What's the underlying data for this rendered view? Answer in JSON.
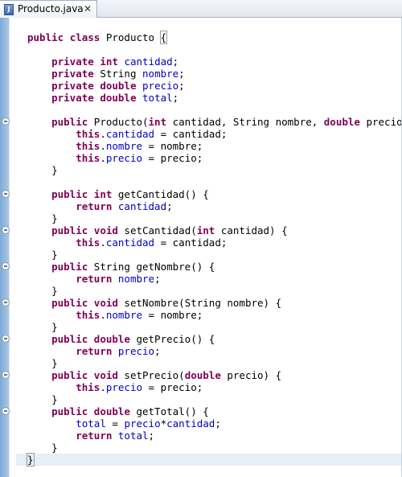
{
  "tab": {
    "title": "Producto.java",
    "icon": "java-file-icon",
    "close_icon": "close-icon"
  },
  "colors": {
    "keyword": "#7f0055",
    "field": "#0000c0",
    "text": "#000000",
    "current_line": "#e6eef8"
  },
  "lines": [
    {
      "fold": false,
      "tokens": [
        {
          "t": "kw",
          "s": "public"
        },
        {
          "t": "p",
          "s": " "
        },
        {
          "t": "kw",
          "s": "class"
        },
        {
          "t": "p",
          "s": " Producto "
        },
        {
          "t": "b",
          "s": "{"
        }
      ]
    },
    {
      "fold": false,
      "tokens": []
    },
    {
      "fold": false,
      "tokens": [
        {
          "t": "p",
          "s": "    "
        },
        {
          "t": "kw",
          "s": "private"
        },
        {
          "t": "p",
          "s": " "
        },
        {
          "t": "kw",
          "s": "int"
        },
        {
          "t": "p",
          "s": " "
        },
        {
          "t": "f",
          "s": "cantidad"
        },
        {
          "t": "p",
          "s": ";"
        }
      ]
    },
    {
      "fold": false,
      "tokens": [
        {
          "t": "p",
          "s": "    "
        },
        {
          "t": "kw",
          "s": "private"
        },
        {
          "t": "p",
          "s": " String "
        },
        {
          "t": "f",
          "s": "nombre"
        },
        {
          "t": "p",
          "s": ";"
        }
      ]
    },
    {
      "fold": false,
      "tokens": [
        {
          "t": "p",
          "s": "    "
        },
        {
          "t": "kw",
          "s": "private"
        },
        {
          "t": "p",
          "s": " "
        },
        {
          "t": "kw",
          "s": "double"
        },
        {
          "t": "p",
          "s": " "
        },
        {
          "t": "f",
          "s": "precio"
        },
        {
          "t": "p",
          "s": ";"
        }
      ]
    },
    {
      "fold": false,
      "tokens": [
        {
          "t": "p",
          "s": "    "
        },
        {
          "t": "kw",
          "s": "private"
        },
        {
          "t": "p",
          "s": " "
        },
        {
          "t": "kw",
          "s": "double"
        },
        {
          "t": "p",
          "s": " "
        },
        {
          "t": "f",
          "s": "total"
        },
        {
          "t": "p",
          "s": ";"
        }
      ]
    },
    {
      "fold": false,
      "tokens": []
    },
    {
      "fold": true,
      "tokens": [
        {
          "t": "p",
          "s": "    "
        },
        {
          "t": "kw",
          "s": "public"
        },
        {
          "t": "p",
          "s": " Producto("
        },
        {
          "t": "kw",
          "s": "int"
        },
        {
          "t": "p",
          "s": " cantidad, String nombre, "
        },
        {
          "t": "kw",
          "s": "double"
        },
        {
          "t": "p",
          "s": " precio) {"
        }
      ]
    },
    {
      "fold": false,
      "tokens": [
        {
          "t": "p",
          "s": "        "
        },
        {
          "t": "kw",
          "s": "this"
        },
        {
          "t": "p",
          "s": "."
        },
        {
          "t": "f",
          "s": "cantidad"
        },
        {
          "t": "p",
          "s": " = cantidad;"
        }
      ]
    },
    {
      "fold": false,
      "tokens": [
        {
          "t": "p",
          "s": "        "
        },
        {
          "t": "kw",
          "s": "this"
        },
        {
          "t": "p",
          "s": "."
        },
        {
          "t": "f",
          "s": "nombre"
        },
        {
          "t": "p",
          "s": " = nombre;"
        }
      ]
    },
    {
      "fold": false,
      "tokens": [
        {
          "t": "p",
          "s": "        "
        },
        {
          "t": "kw",
          "s": "this"
        },
        {
          "t": "p",
          "s": "."
        },
        {
          "t": "f",
          "s": "precio"
        },
        {
          "t": "p",
          "s": " = precio;"
        }
      ]
    },
    {
      "fold": false,
      "tokens": [
        {
          "t": "p",
          "s": "    }"
        }
      ]
    },
    {
      "fold": false,
      "tokens": []
    },
    {
      "fold": true,
      "tokens": [
        {
          "t": "p",
          "s": "    "
        },
        {
          "t": "kw",
          "s": "public"
        },
        {
          "t": "p",
          "s": " "
        },
        {
          "t": "kw",
          "s": "int"
        },
        {
          "t": "p",
          "s": " getCantidad() {"
        }
      ]
    },
    {
      "fold": false,
      "tokens": [
        {
          "t": "p",
          "s": "        "
        },
        {
          "t": "kw",
          "s": "return"
        },
        {
          "t": "p",
          "s": " "
        },
        {
          "t": "f",
          "s": "cantidad"
        },
        {
          "t": "p",
          "s": ";"
        }
      ]
    },
    {
      "fold": false,
      "tokens": [
        {
          "t": "p",
          "s": "    }"
        }
      ]
    },
    {
      "fold": true,
      "tokens": [
        {
          "t": "p",
          "s": "    "
        },
        {
          "t": "kw",
          "s": "public"
        },
        {
          "t": "p",
          "s": " "
        },
        {
          "t": "kw",
          "s": "void"
        },
        {
          "t": "p",
          "s": " setCantidad("
        },
        {
          "t": "kw",
          "s": "int"
        },
        {
          "t": "p",
          "s": " cantidad) {"
        }
      ]
    },
    {
      "fold": false,
      "tokens": [
        {
          "t": "p",
          "s": "        "
        },
        {
          "t": "kw",
          "s": "this"
        },
        {
          "t": "p",
          "s": "."
        },
        {
          "t": "f",
          "s": "cantidad"
        },
        {
          "t": "p",
          "s": " = cantidad;"
        }
      ]
    },
    {
      "fold": false,
      "tokens": [
        {
          "t": "p",
          "s": "    }"
        }
      ]
    },
    {
      "fold": true,
      "tokens": [
        {
          "t": "p",
          "s": "    "
        },
        {
          "t": "kw",
          "s": "public"
        },
        {
          "t": "p",
          "s": " String getNombre() {"
        }
      ]
    },
    {
      "fold": false,
      "tokens": [
        {
          "t": "p",
          "s": "        "
        },
        {
          "t": "kw",
          "s": "return"
        },
        {
          "t": "p",
          "s": " "
        },
        {
          "t": "f",
          "s": "nombre"
        },
        {
          "t": "p",
          "s": ";"
        }
      ]
    },
    {
      "fold": false,
      "tokens": [
        {
          "t": "p",
          "s": "    }"
        }
      ]
    },
    {
      "fold": true,
      "tokens": [
        {
          "t": "p",
          "s": "    "
        },
        {
          "t": "kw",
          "s": "public"
        },
        {
          "t": "p",
          "s": " "
        },
        {
          "t": "kw",
          "s": "void"
        },
        {
          "t": "p",
          "s": " setNombre(String nombre) {"
        }
      ]
    },
    {
      "fold": false,
      "tokens": [
        {
          "t": "p",
          "s": "        "
        },
        {
          "t": "kw",
          "s": "this"
        },
        {
          "t": "p",
          "s": "."
        },
        {
          "t": "f",
          "s": "nombre"
        },
        {
          "t": "p",
          "s": " = nombre;"
        }
      ]
    },
    {
      "fold": false,
      "tokens": [
        {
          "t": "p",
          "s": "    }"
        }
      ]
    },
    {
      "fold": true,
      "tokens": [
        {
          "t": "p",
          "s": "    "
        },
        {
          "t": "kw",
          "s": "public"
        },
        {
          "t": "p",
          "s": " "
        },
        {
          "t": "kw",
          "s": "double"
        },
        {
          "t": "p",
          "s": " getPrecio() {"
        }
      ]
    },
    {
      "fold": false,
      "tokens": [
        {
          "t": "p",
          "s": "        "
        },
        {
          "t": "kw",
          "s": "return"
        },
        {
          "t": "p",
          "s": " "
        },
        {
          "t": "f",
          "s": "precio"
        },
        {
          "t": "p",
          "s": ";"
        }
      ]
    },
    {
      "fold": false,
      "tokens": [
        {
          "t": "p",
          "s": "    }"
        }
      ]
    },
    {
      "fold": true,
      "tokens": [
        {
          "t": "p",
          "s": "    "
        },
        {
          "t": "kw",
          "s": "public"
        },
        {
          "t": "p",
          "s": " "
        },
        {
          "t": "kw",
          "s": "void"
        },
        {
          "t": "p",
          "s": " setPrecio("
        },
        {
          "t": "kw",
          "s": "double"
        },
        {
          "t": "p",
          "s": " precio) {"
        }
      ]
    },
    {
      "fold": false,
      "tokens": [
        {
          "t": "p",
          "s": "        "
        },
        {
          "t": "kw",
          "s": "this"
        },
        {
          "t": "p",
          "s": "."
        },
        {
          "t": "f",
          "s": "precio"
        },
        {
          "t": "p",
          "s": " = precio;"
        }
      ]
    },
    {
      "fold": false,
      "tokens": [
        {
          "t": "p",
          "s": "    }"
        }
      ]
    },
    {
      "fold": true,
      "tokens": [
        {
          "t": "p",
          "s": "    "
        },
        {
          "t": "kw",
          "s": "public"
        },
        {
          "t": "p",
          "s": " "
        },
        {
          "t": "kw",
          "s": "double"
        },
        {
          "t": "p",
          "s": " getTotal() {"
        }
      ]
    },
    {
      "fold": false,
      "tokens": [
        {
          "t": "p",
          "s": "        "
        },
        {
          "t": "f",
          "s": "total"
        },
        {
          "t": "p",
          "s": " = "
        },
        {
          "t": "f",
          "s": "precio"
        },
        {
          "t": "p",
          "s": "*"
        },
        {
          "t": "f",
          "s": "cantidad"
        },
        {
          "t": "p",
          "s": ";"
        }
      ]
    },
    {
      "fold": false,
      "tokens": [
        {
          "t": "p",
          "s": "        "
        },
        {
          "t": "kw",
          "s": "return"
        },
        {
          "t": "p",
          "s": " "
        },
        {
          "t": "f",
          "s": "total"
        },
        {
          "t": "p",
          "s": ";"
        }
      ]
    },
    {
      "fold": false,
      "tokens": [
        {
          "t": "p",
          "s": "    }"
        }
      ]
    },
    {
      "fold": false,
      "current": true,
      "tokens": [
        {
          "t": "b",
          "s": "}"
        },
        {
          "t": "caret",
          "s": ""
        }
      ]
    }
  ]
}
